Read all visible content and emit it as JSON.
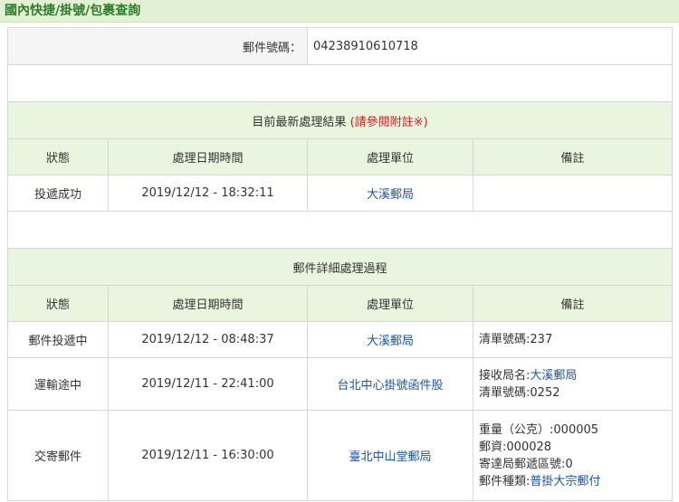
{
  "page_title": "國內快捷/掛號/包裹查詢",
  "mail_number": {
    "label": "郵件號碼：",
    "value": "04238910610718"
  },
  "latest": {
    "title": "目前最新處理結果",
    "note": "(請參閱附註※)",
    "headers": [
      "狀態",
      "處理日期時間",
      "處理單位",
      "備註"
    ],
    "row": {
      "status": "投遞成功",
      "datetime": "2019/12/12 - 18:32:11",
      "unit": "大溪郵局",
      "remarks": ""
    }
  },
  "detail": {
    "title": "郵件詳細處理過程",
    "headers": [
      "狀態",
      "處理日期時間",
      "處理單位",
      "備註"
    ],
    "rows": [
      {
        "status": "郵件投遞中",
        "datetime": "2019/12/12 - 08:48:37",
        "unit": "大溪郵局",
        "remarks": {
          "line1": "清單號碼:237"
        }
      },
      {
        "status": "運輸途中",
        "datetime": "2019/12/11 - 22:41:00",
        "unit": "台北中心掛號函件股",
        "remarks": {
          "line1_label": "接收局名:",
          "line1_link": "大溪郵局",
          "line2": "清單號碼:0252"
        }
      },
      {
        "status": "交寄郵件",
        "datetime": "2019/12/11 - 16:30:00",
        "unit": "臺北中山堂郵局",
        "remarks": {
          "line1": "重量（公克）:000005",
          "line2": "郵資:000028",
          "line3": "寄達局郵遞區號:0",
          "line4_label": "郵件種類:",
          "line4_link": "普掛大宗郵付"
        }
      }
    ]
  },
  "colors": {
    "header_bg": "#eaf5e0",
    "title_bg": "#e2f0d3",
    "title_text": "#2e7d2e",
    "link": "#1a55a8",
    "note": "#cc2222"
  }
}
